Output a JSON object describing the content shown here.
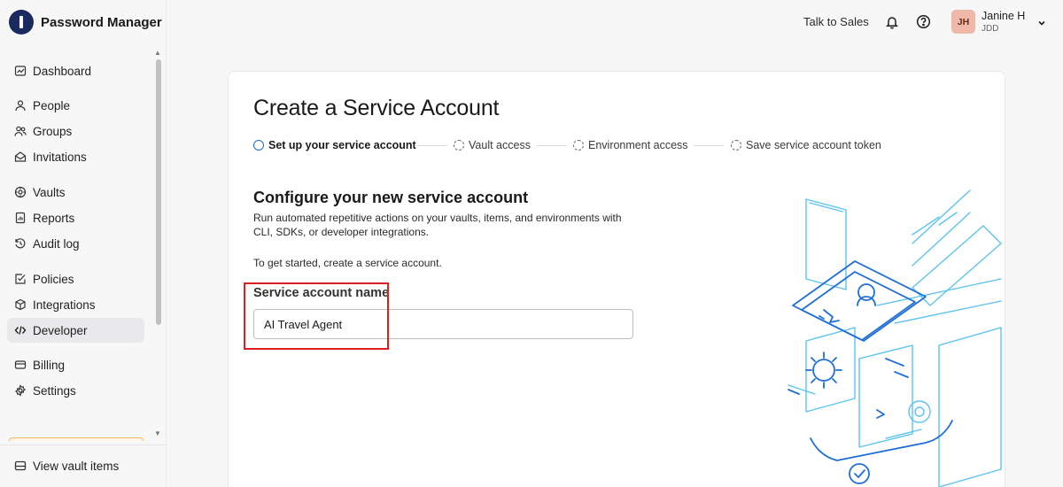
{
  "brand": {
    "name": "Password Manager"
  },
  "sidebar": {
    "items": [
      {
        "label": "Dashboard",
        "icon": "dashboard-icon"
      },
      {
        "label": "People",
        "icon": "person-icon"
      },
      {
        "label": "Groups",
        "icon": "groups-icon"
      },
      {
        "label": "Invitations",
        "icon": "envelope-icon"
      },
      {
        "label": "Vaults",
        "icon": "vault-icon"
      },
      {
        "label": "Reports",
        "icon": "report-icon"
      },
      {
        "label": "Audit log",
        "icon": "history-icon"
      },
      {
        "label": "Policies",
        "icon": "checklist-icon"
      },
      {
        "label": "Integrations",
        "icon": "cube-icon"
      },
      {
        "label": "Developer",
        "icon": "code-icon",
        "active": true
      },
      {
        "label": "Billing",
        "icon": "card-icon"
      },
      {
        "label": "Settings",
        "icon": "gear-icon"
      }
    ],
    "footer": {
      "label": "View vault items",
      "icon": "vault-items-icon"
    }
  },
  "header": {
    "talk_to_sales": "Talk to Sales",
    "user": {
      "initials": "JH",
      "name": "Janine H",
      "org": "JDD"
    }
  },
  "main": {
    "title": "Create a Service Account",
    "steps": [
      {
        "label": "Set up your service account",
        "state": "active"
      },
      {
        "label": "Vault access",
        "state": "pending"
      },
      {
        "label": "Environment access",
        "state": "pending"
      },
      {
        "label": "Save service account token",
        "state": "pending"
      }
    ],
    "section_title": "Configure your new service account",
    "section_desc": "Run automated repetitive actions on your vaults, items, and environments with CLI, SDKs, or developer integrations.",
    "get_started": "To get started, create a service account.",
    "field_label": "Service account name",
    "field_value": "AI Travel Agent"
  },
  "colors": {
    "accent": "#1a6ae0",
    "highlight": "#e02020",
    "illustration_dark": "#1f6fd6",
    "illustration_light": "#5cc3f0"
  }
}
